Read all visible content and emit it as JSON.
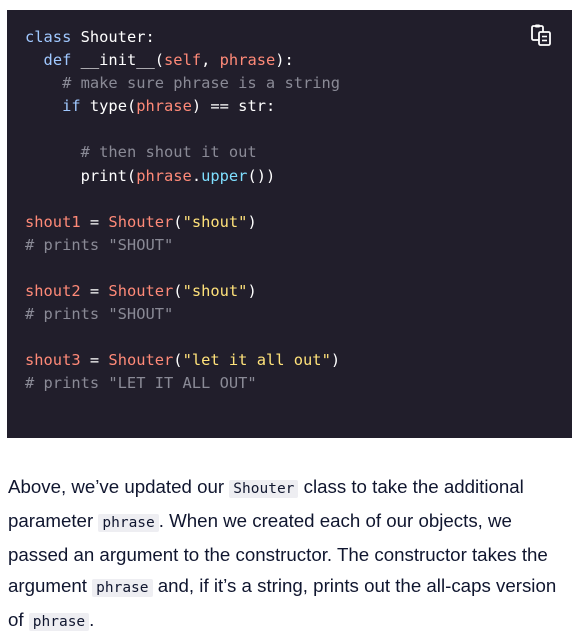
{
  "code_block": {
    "copy_icon": "copy-clipboard-icon",
    "lines": [
      [
        {
          "t": "kw",
          "v": "class "
        },
        {
          "t": "plain",
          "v": "Shouter:"
        }
      ],
      [
        {
          "t": "plain",
          "v": "  "
        },
        {
          "t": "kw",
          "v": "def "
        },
        {
          "t": "plain",
          "v": "__init__("
        },
        {
          "t": "self",
          "v": "self"
        },
        {
          "t": "plain",
          "v": ", "
        },
        {
          "t": "param",
          "v": "phrase"
        },
        {
          "t": "plain",
          "v": "):"
        }
      ],
      [
        {
          "t": "plain",
          "v": "    "
        },
        {
          "t": "comment",
          "v": "# make sure phrase is a string"
        }
      ],
      [
        {
          "t": "plain",
          "v": "    "
        },
        {
          "t": "kw",
          "v": "if "
        },
        {
          "t": "plain",
          "v": "type("
        },
        {
          "t": "param",
          "v": "phrase"
        },
        {
          "t": "plain",
          "v": ") == str:"
        }
      ],
      [
        {
          "t": "plain",
          "v": ""
        }
      ],
      [
        {
          "t": "plain",
          "v": "      "
        },
        {
          "t": "comment",
          "v": "# then shout it out"
        }
      ],
      [
        {
          "t": "plain",
          "v": "      print("
        },
        {
          "t": "param",
          "v": "phrase"
        },
        {
          "t": "plain",
          "v": "."
        },
        {
          "t": "method",
          "v": "upper"
        },
        {
          "t": "plain",
          "v": "())"
        }
      ],
      [
        {
          "t": "plain",
          "v": ""
        }
      ],
      [
        {
          "t": "var",
          "v": "shout1"
        },
        {
          "t": "plain",
          "v": " = "
        },
        {
          "t": "call",
          "v": "Shouter"
        },
        {
          "t": "plain",
          "v": "("
        },
        {
          "t": "str",
          "v": "\"shout\""
        },
        {
          "t": "plain",
          "v": ")"
        }
      ],
      [
        {
          "t": "comment",
          "v": "# prints \"SHOUT\""
        }
      ],
      [
        {
          "t": "plain",
          "v": ""
        }
      ],
      [
        {
          "t": "var",
          "v": "shout2"
        },
        {
          "t": "plain",
          "v": " = "
        },
        {
          "t": "call",
          "v": "Shouter"
        },
        {
          "t": "plain",
          "v": "("
        },
        {
          "t": "str",
          "v": "\"shout\""
        },
        {
          "t": "plain",
          "v": ")"
        }
      ],
      [
        {
          "t": "comment",
          "v": "# prints \"SHOUT\""
        }
      ],
      [
        {
          "t": "plain",
          "v": ""
        }
      ],
      [
        {
          "t": "var",
          "v": "shout3"
        },
        {
          "t": "plain",
          "v": " = "
        },
        {
          "t": "call",
          "v": "Shouter"
        },
        {
          "t": "plain",
          "v": "("
        },
        {
          "t": "str",
          "v": "\"let it all out\""
        },
        {
          "t": "plain",
          "v": ")"
        }
      ],
      [
        {
          "t": "comment",
          "v": "# prints \"LET IT ALL OUT\""
        }
      ]
    ]
  },
  "prose": {
    "parts": [
      {
        "t": "text",
        "v": "Above, we’ve updated our "
      },
      {
        "t": "code",
        "v": "Shouter"
      },
      {
        "t": "text",
        "v": " class to take the additional parameter "
      },
      {
        "t": "code",
        "v": "phrase"
      },
      {
        "t": "text",
        "v": ". When we created each of our objects, we passed an argument to the constructor. The constructor takes the argument "
      },
      {
        "t": "code",
        "v": "phrase"
      },
      {
        "t": "text",
        "v": " and, if it’s a string, prints out the all-caps version of "
      },
      {
        "t": "code",
        "v": "phrase"
      },
      {
        "t": "text",
        "v": "."
      }
    ]
  },
  "colors": {
    "code_background": "#211e2b",
    "keyword": "#a0c8ff",
    "string": "#ffe27a",
    "variable": "#ff8a78",
    "comment": "#8a8a96",
    "method": "#7fdfff",
    "prose_text": "#10162f",
    "inline_code_background": "#eeeef2"
  }
}
